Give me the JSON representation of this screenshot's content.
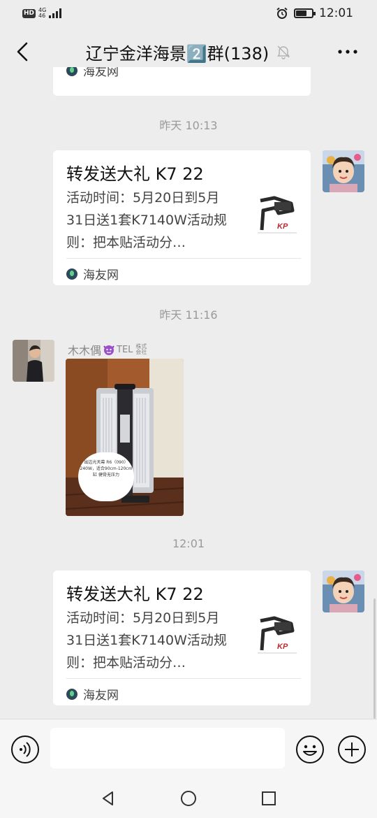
{
  "status_bar": {
    "hd_label": "HD",
    "network_label": "4G",
    "network_sub": "46",
    "time": "12:01",
    "battery_level": 0.7
  },
  "nav": {
    "title": "辽宁金洋海景2️⃣群(138)",
    "title_prefix": "辽宁金洋海景",
    "title_badge": "2",
    "title_suffix": "群(138)"
  },
  "messages": {
    "top_partial_source": "海友网",
    "timestamp_1": "昨天 10:13",
    "card_1": {
      "title": "转发送大礼 K7 22",
      "desc": "活动时间：5月20日到5月31日送1套K7140W活动规则：把本贴活动分…",
      "source": "海友网"
    },
    "timestamp_2": "昨天 11:16",
    "sender_name": "木木偶",
    "sender_tel": "TEL",
    "sender_tel_small_1": "株式",
    "sender_tel_small_2": "会社",
    "photo_caption": "出边光天幕 R6（090）240W，适合90cm-120cm缸 健骨无压力",
    "timestamp_3": "12:01",
    "card_2": {
      "title": "转发送大礼 K7 22",
      "desc": "活动时间：5月20日到5月31日送1套K7140W活动规则：把本贴活动分…",
      "source": "海友网"
    }
  },
  "input": {
    "placeholder": ""
  },
  "icons": {
    "back": "back-arrow-icon",
    "mute": "mute-bell-icon",
    "more": "more-dots-icon",
    "voice": "voice-icon",
    "emoji": "emoji-icon",
    "plus": "plus-icon"
  },
  "colors": {
    "background": "#ededed",
    "card": "#ffffff",
    "timestamp": "#9a9a9a",
    "badge_blue": "#5b8def"
  }
}
